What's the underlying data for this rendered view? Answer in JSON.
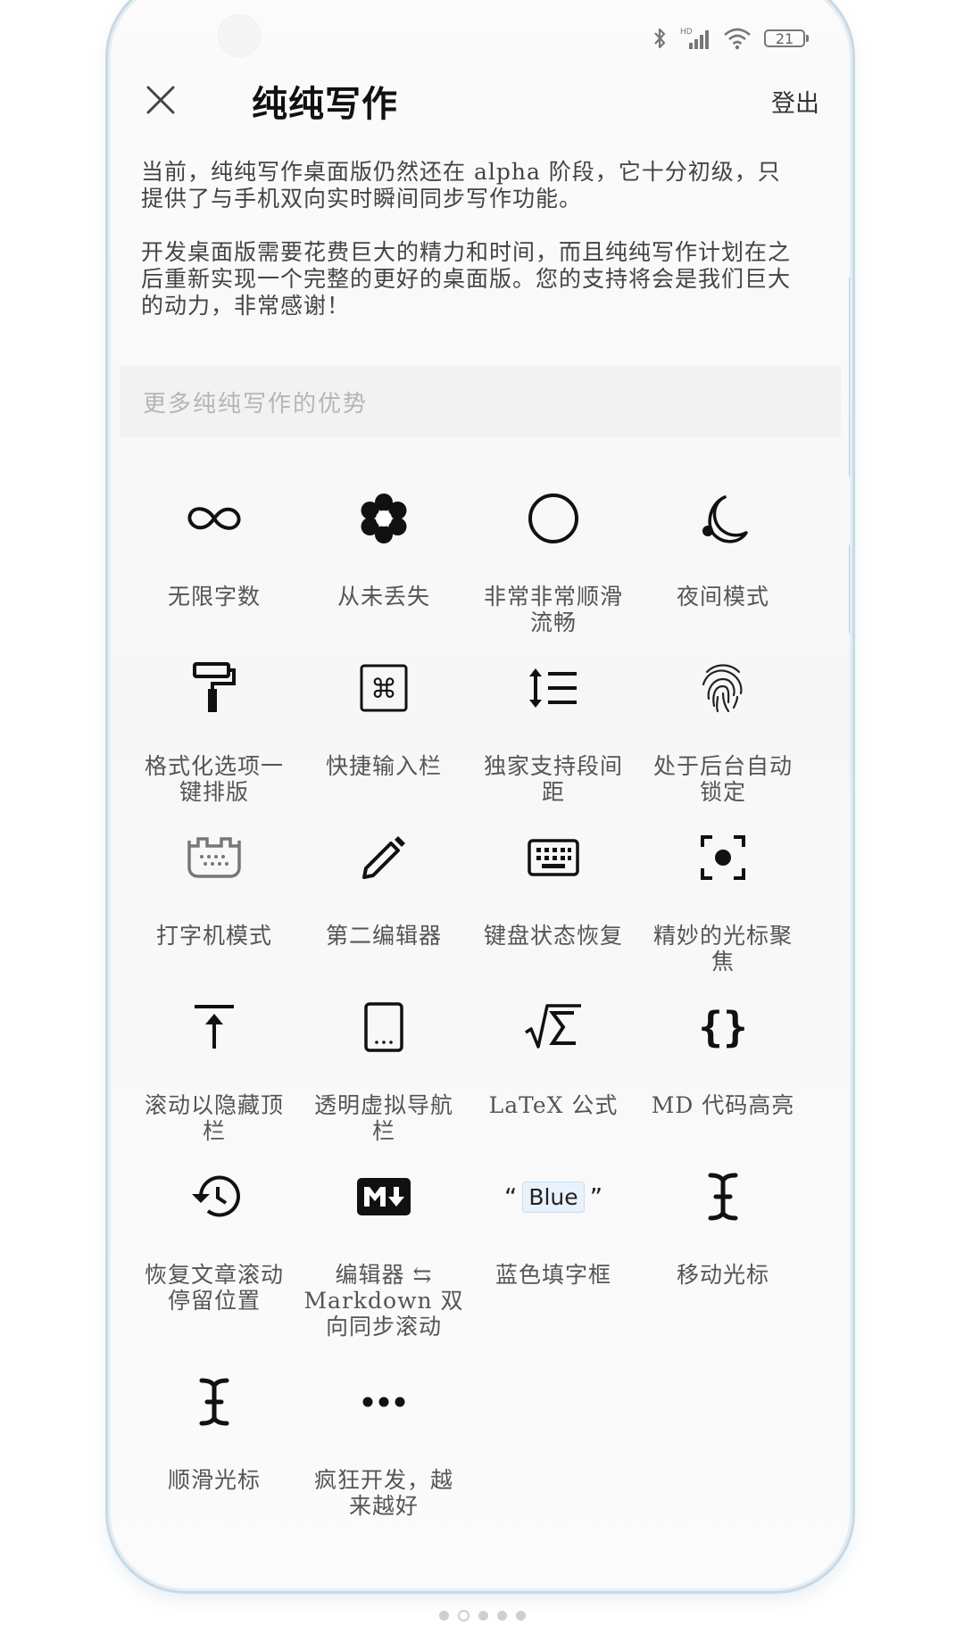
{
  "status": {
    "battery": "21",
    "network": "HD"
  },
  "header": {
    "title": "纯纯写作",
    "logout": "登出"
  },
  "intro": {
    "p1": "当前，纯纯写作桌面版仍然还在 alpha 阶段，它十分初级，只提供了与手机双向实时瞬间同步写作功能。",
    "p2": "开发桌面版需要花费巨大的精力和时间，而且纯纯写作计划在之后重新实现一个完整的更好的桌面版。您的支持将会是我们巨大的动力，非常感谢！"
  },
  "more_label": "更多纯纯写作的优势",
  "features": [
    {
      "icon": "infinity-icon",
      "label": "无限字数"
    },
    {
      "icon": "flower-icon",
      "label": "从未丢失"
    },
    {
      "icon": "circle-icon",
      "label": "非常非常顺滑流畅"
    },
    {
      "icon": "moon-icon",
      "label": "夜间模式"
    },
    {
      "icon": "paint-roller-icon",
      "label": "格式化选项一键排版"
    },
    {
      "icon": "command-key-icon",
      "label": "快捷输入栏"
    },
    {
      "icon": "line-spacing-icon",
      "label": "独家支持段间距"
    },
    {
      "icon": "fingerprint-icon",
      "label": "处于后台自动锁定"
    },
    {
      "icon": "typewriter-icon",
      "label": "打字机模式"
    },
    {
      "icon": "pencil-icon",
      "label": "第二编辑器"
    },
    {
      "icon": "keyboard-icon",
      "label": "键盘状态恢复"
    },
    {
      "icon": "cursor-focus-icon",
      "label": "精妙的光标聚焦"
    },
    {
      "icon": "scroll-top-icon",
      "label": "滚动以隐藏顶栏"
    },
    {
      "icon": "tablet-icon",
      "label": "透明虚拟导航栏"
    },
    {
      "icon": "sqrt-sigma-icon",
      "label": "LaTeX 公式"
    },
    {
      "icon": "braces-icon",
      "label": "MD 代码高亮"
    },
    {
      "icon": "history-icon",
      "label": "恢复文章滚动停留位置"
    },
    {
      "icon": "markdown-icon",
      "label": "编辑器 ⇆ Markdown 双向同步滚动"
    },
    {
      "icon": "blue-fill-icon",
      "label": "蓝色填字框",
      "sample": "Blue"
    },
    {
      "icon": "text-cursor-icon",
      "label": "移动光标"
    },
    {
      "icon": "smooth-cursor-icon",
      "label": "顺滑光标"
    },
    {
      "icon": "more-dots-icon",
      "label": "疯狂开发，越来越好"
    }
  ],
  "pager": {
    "count": 5,
    "active": 2
  }
}
